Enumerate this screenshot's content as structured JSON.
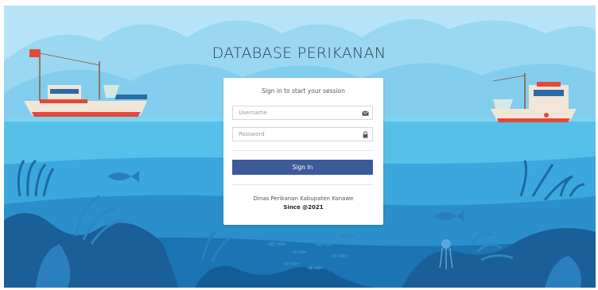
{
  "app": {
    "title": "DATABASE PERIKANAN"
  },
  "login": {
    "message": "Sign in to start your session",
    "username_placeholder": "Username",
    "password_placeholder": "Password",
    "username_icon": "envelope-icon",
    "password_icon": "lock-icon",
    "signin_label": "Sign In",
    "footer_org": "Dinas Perikanan Kabupaten Konawe",
    "footer_since": "Since @2021"
  },
  "colors": {
    "sky": "#a9def3",
    "sea": "#5bc3e8",
    "deep_sea": "#1a6aa8",
    "button": "#3c5a99"
  }
}
